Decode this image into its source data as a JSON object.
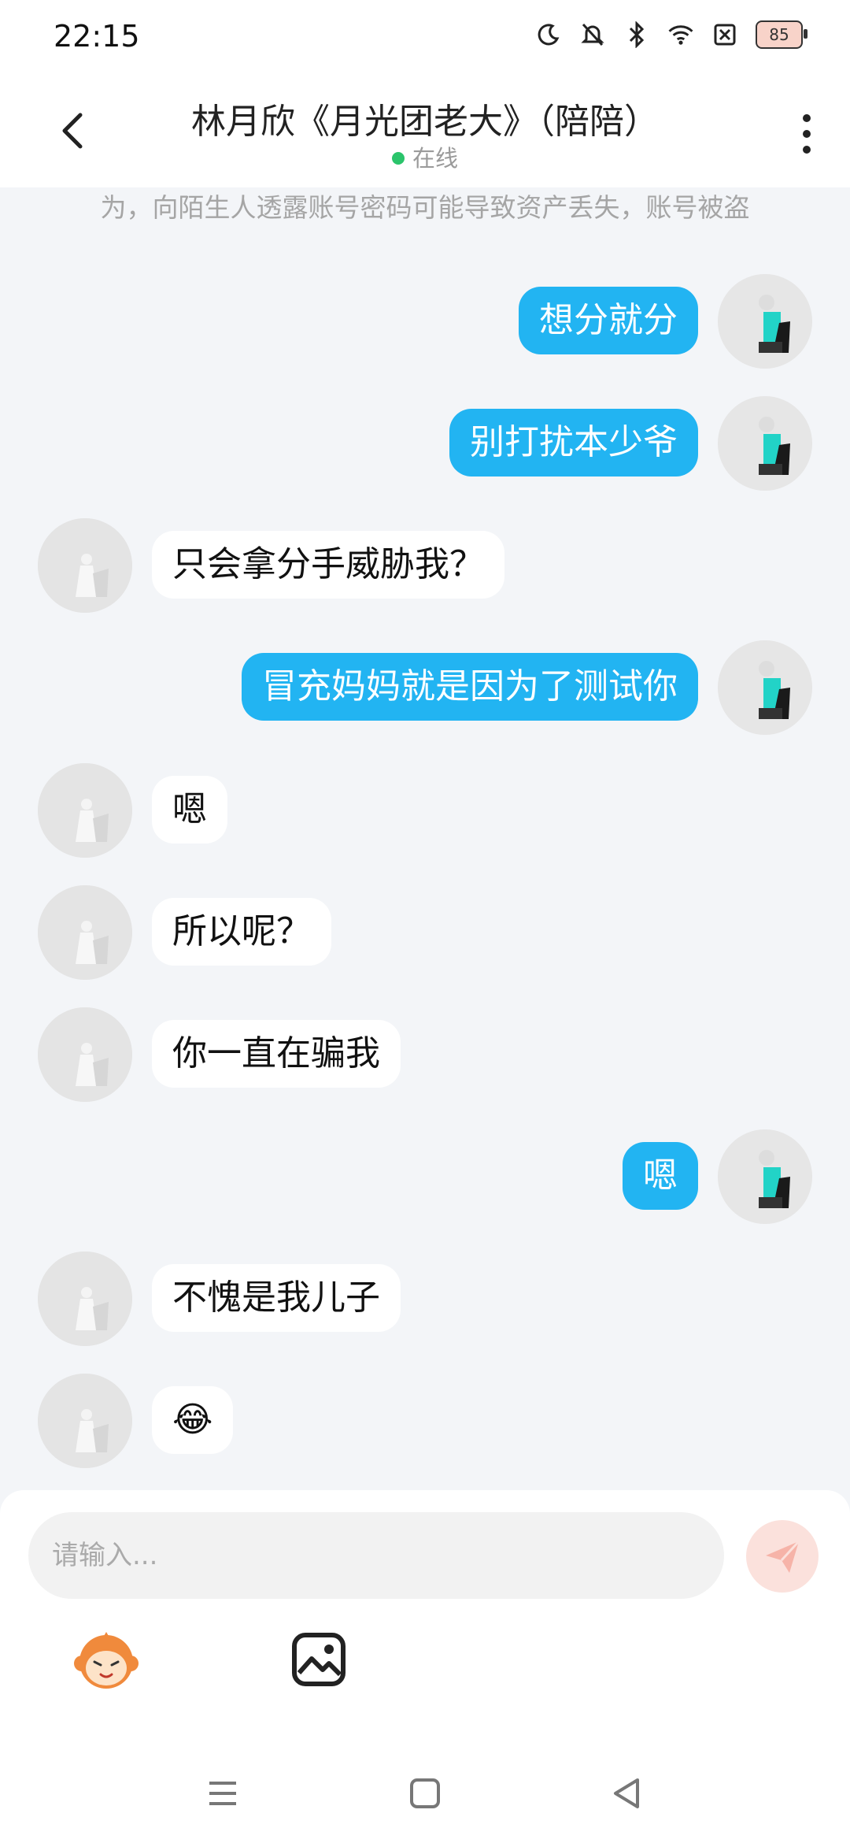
{
  "status_bar": {
    "time": "22:15",
    "icons": [
      "moon-icon",
      "bell-mute-icon",
      "bluetooth-icon",
      "wifi-icon",
      "sim-off-icon"
    ],
    "battery": "85"
  },
  "header": {
    "title": "林月欣《月光团老大》（陪陪）",
    "status": "在线",
    "status_color": "#2bc46b"
  },
  "chat": {
    "notice_partial": "为，向陌生人透露账号密码可能导致资产丢失，账号被盗",
    "messages": [
      {
        "from": "me",
        "text": "想分就分"
      },
      {
        "from": "me",
        "text": "别打扰本少爷"
      },
      {
        "from": "them",
        "text": "只会拿分手威胁我？"
      },
      {
        "from": "me",
        "text": "冒充妈妈就是因为了测试你"
      },
      {
        "from": "them",
        "text": "嗯"
      },
      {
        "from": "them",
        "text": "所以呢？"
      },
      {
        "from": "them",
        "text": "你一直在骗我"
      },
      {
        "from": "me",
        "text": "嗯"
      },
      {
        "from": "them",
        "text": "不愧是我儿子"
      },
      {
        "from": "them",
        "text": "😂"
      }
    ]
  },
  "input": {
    "placeholder": "请输入..."
  },
  "colors": {
    "my_bubble": "#22b4f2",
    "their_bubble": "#ffffff",
    "background": "#f3f5f8"
  }
}
